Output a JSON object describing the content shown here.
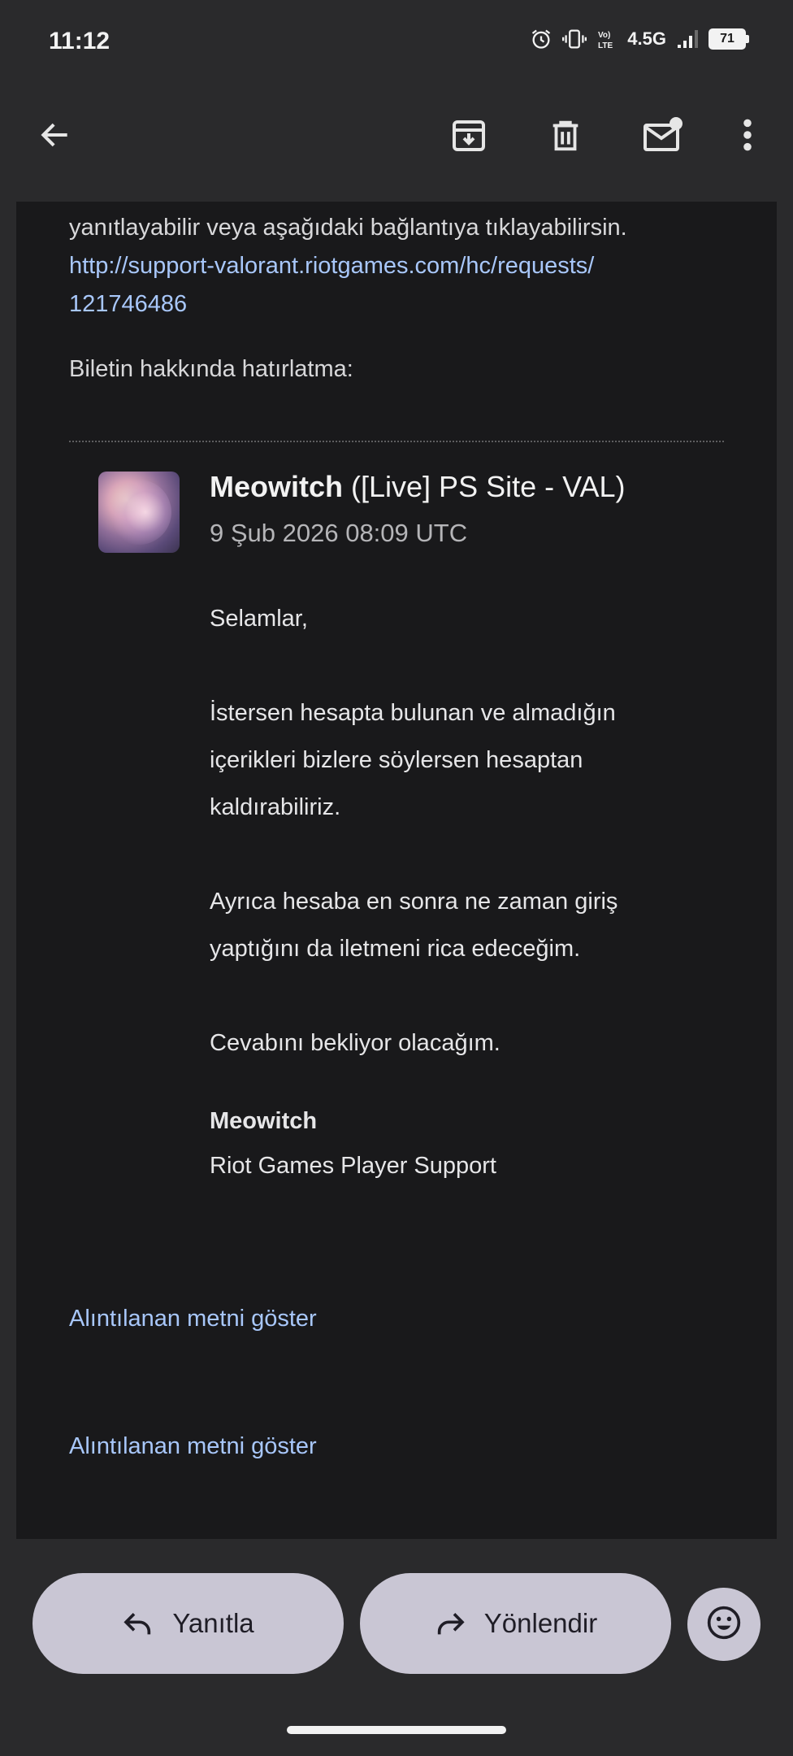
{
  "status_bar": {
    "time": "11:12",
    "network": "4.5G",
    "battery": "71"
  },
  "toolbar": {
    "icons": [
      "back-arrow-icon",
      "archive-icon",
      "delete-icon",
      "mark-unread-icon",
      "more-vert-icon"
    ]
  },
  "message": {
    "intro_line": "yanıtlayabilir veya aşağıdaki bağlantıya tıklayabilirsin.",
    "link_part1": "http://support-valorant.riotgames.com/hc/requests/",
    "link_part2": "121746486",
    "reminder": "Biletin hakkında hatırlatma:",
    "quoted_email": {
      "sender_name": "Meowitch",
      "sender_extra": " ([Live] PS Site - VAL)",
      "date": "9 Şub 2026 08:09 UTC",
      "greeting": "Selamlar,",
      "p1_l1": "İstersen hesapta bulunan ve almadığın",
      "p1_l2": "içerikleri bizlere söylersen hesaptan",
      "p1_l3": "kaldırabiliriz.",
      "p2_l1": "Ayrıca hesaba en sonra ne zaman giriş",
      "p2_l2": "yaptığını da iletmeni rica edeceğim.",
      "p3": "Cevabını bekliyor olacağım.",
      "signature_name": "Meowitch",
      "signature_org": "Riot Games Player Support"
    },
    "show_quoted_1": "Alıntılanan metni göster",
    "show_quoted_2": "Alıntılanan metni göster"
  },
  "actions": {
    "reply_label": "Yanıtla",
    "forward_label": "Yönlendir",
    "emoji_icon": "emoji-icon"
  },
  "colors": {
    "background": "#2a2a2c",
    "card": "#19191b",
    "link": "#a8c7fa",
    "pill": "#c9c6d4"
  }
}
